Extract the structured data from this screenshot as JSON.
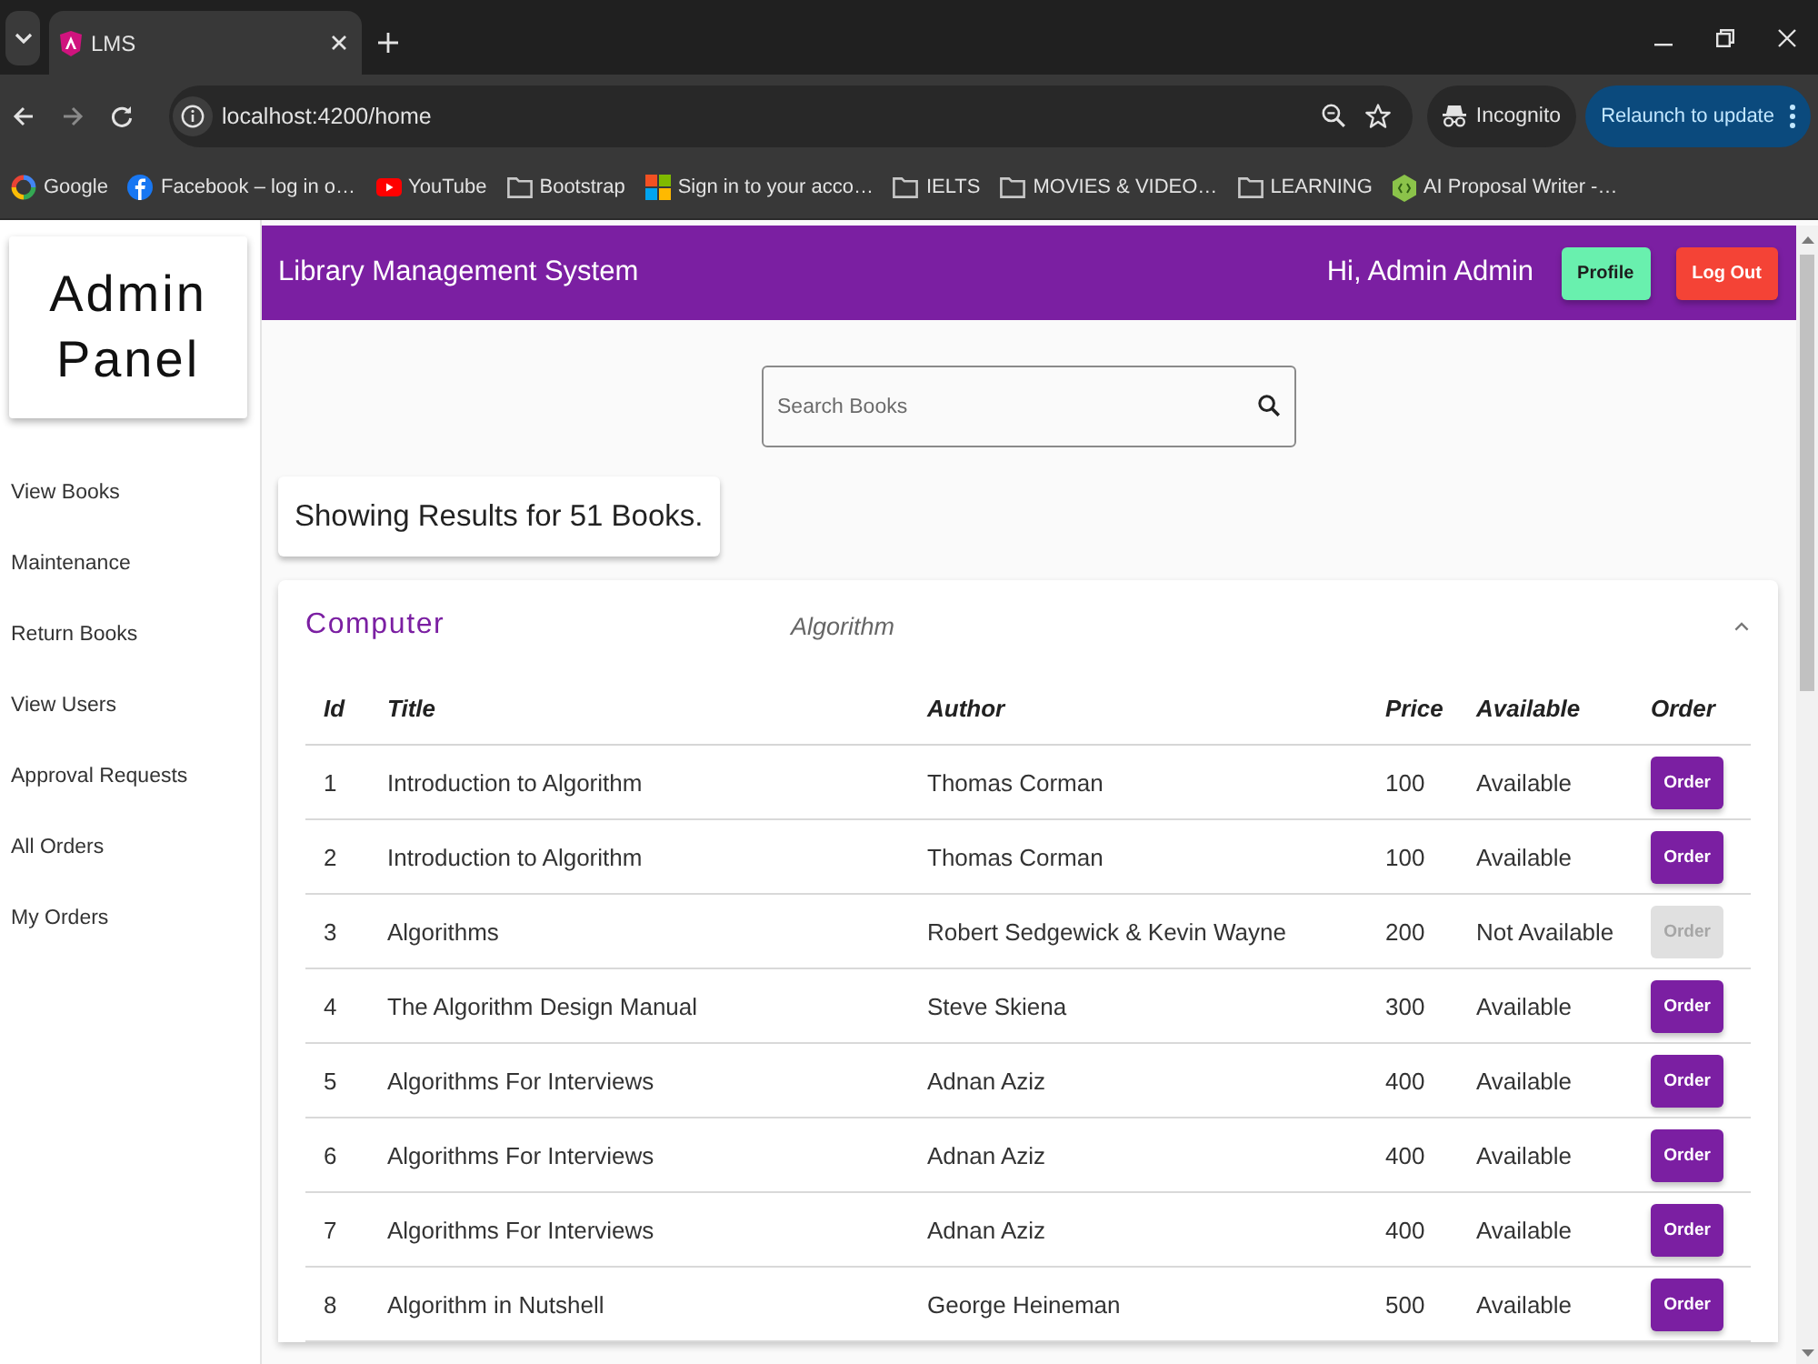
{
  "browser": {
    "tabs": [
      {
        "title": "LMS",
        "selected": true
      }
    ],
    "url": "localhost:4200/home",
    "profile_chip": "Incognito",
    "update_button": "Relaunch to update",
    "bookmarks": [
      {
        "label": "Google",
        "kind": "google"
      },
      {
        "label": "Facebook – log in o…",
        "kind": "facebook"
      },
      {
        "label": "YouTube",
        "kind": "youtube"
      },
      {
        "label": "Bootstrap",
        "kind": "folder"
      },
      {
        "label": "Sign in to your acco…",
        "kind": "microsoft"
      },
      {
        "label": "IELTS",
        "kind": "folder"
      },
      {
        "label": "MOVIES & VIDEO…",
        "kind": "folder"
      },
      {
        "label": "LEARNING",
        "kind": "folder"
      },
      {
        "label": "AI Proposal Writer -…",
        "kind": "site"
      }
    ]
  },
  "sidebar": {
    "title": "Admin Panel",
    "items": [
      "View Books",
      "Maintenance",
      "Return Books",
      "View Users",
      "Approval Requests",
      "All Orders",
      "My Orders"
    ]
  },
  "header": {
    "title": "Library Management System",
    "greeting": "Hi, Admin Admin",
    "buttons": [
      {
        "label": "Profile",
        "kind": "profile"
      },
      {
        "label": "Log Out",
        "kind": "logout"
      }
    ]
  },
  "search": {
    "placeholder": "Search Books"
  },
  "results_summary": "Showing Results for 51 Books.",
  "panel": {
    "title": "Computer",
    "subtitle": "Algorithm",
    "expanded": true,
    "table": {
      "columns": [
        "Id",
        "Title",
        "Author",
        "Price",
        "Available",
        "Order"
      ],
      "rows": [
        {
          "id": "1",
          "title": "Introduction to Algorithm",
          "author": "Thomas Corman",
          "price": "100",
          "availability": "Available",
          "order": {
            "label": "Order",
            "disabled": false
          }
        },
        {
          "id": "2",
          "title": "Introduction to Algorithm",
          "author": "Thomas Corman",
          "price": "100",
          "availability": "Available",
          "order": {
            "label": "Order",
            "disabled": false
          }
        },
        {
          "id": "3",
          "title": "Algorithms",
          "author": "Robert Sedgewick & Kevin Wayne",
          "price": "200",
          "availability": "Not Available",
          "order": {
            "label": "Order",
            "disabled": true
          }
        },
        {
          "id": "4",
          "title": "The Algorithm Design Manual",
          "author": "Steve Skiena",
          "price": "300",
          "availability": "Available",
          "order": {
            "label": "Order",
            "disabled": false
          }
        },
        {
          "id": "5",
          "title": "Algorithms For Interviews",
          "author": "Adnan Aziz",
          "price": "400",
          "availability": "Available",
          "order": {
            "label": "Order",
            "disabled": false
          }
        },
        {
          "id": "6",
          "title": "Algorithms For Interviews",
          "author": "Adnan Aziz",
          "price": "400",
          "availability": "Available",
          "order": {
            "label": "Order",
            "disabled": false
          }
        },
        {
          "id": "7",
          "title": "Algorithms For Interviews",
          "author": "Adnan Aziz",
          "price": "400",
          "availability": "Available",
          "order": {
            "label": "Order",
            "disabled": false
          }
        },
        {
          "id": "8",
          "title": "Algorithm in Nutshell",
          "author": "George Heineman",
          "price": "500",
          "availability": "Available",
          "order": {
            "label": "Order",
            "disabled": false
          }
        }
      ]
    }
  }
}
